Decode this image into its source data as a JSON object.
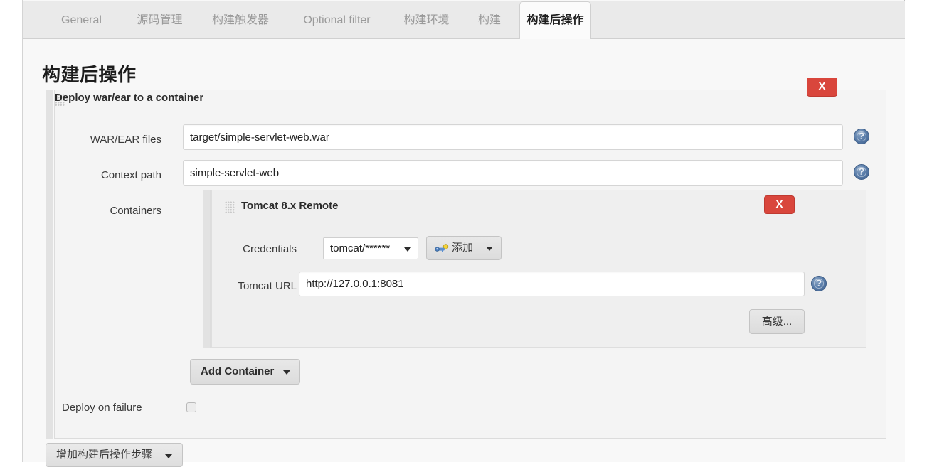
{
  "tabs": [
    {
      "label": "General",
      "active": false
    },
    {
      "label": "源码管理",
      "active": false
    },
    {
      "label": "构建触发器",
      "active": false
    },
    {
      "label": "Optional filter",
      "active": false
    },
    {
      "label": "构建环境",
      "active": false
    },
    {
      "label": "构建",
      "active": false
    },
    {
      "label": "构建后操作",
      "active": true
    }
  ],
  "page": {
    "title": "构建后操作"
  },
  "post_build_step": {
    "title": "Deploy war/ear to a container",
    "remove_label": "X",
    "fields": {
      "war_ear_files": {
        "label": "WAR/EAR files",
        "value": "target/simple-servlet-web.war",
        "help_icon": "help-icon"
      },
      "context_path": {
        "label": "Context path",
        "value": "simple-servlet-web",
        "help_icon": "help-icon"
      },
      "containers": {
        "label": "Containers"
      },
      "deploy_on_failure": {
        "label": "Deploy on failure",
        "checked": false
      }
    },
    "container": {
      "title": "Tomcat 8.x Remote",
      "remove_label": "X",
      "credentials": {
        "label": "Credentials",
        "selected": "tomcat/******",
        "add_button_label": "添加",
        "add_button_icon": "key-icon",
        "dropdown_icon": "chevron-down-icon"
      },
      "tomcat_url": {
        "label": "Tomcat URL",
        "value": "http://127.0.0.1:8081",
        "help_icon": "help-icon"
      },
      "advanced_button_label": "高级..."
    },
    "add_container_button": {
      "label": "Add Container",
      "dropdown_icon": "chevron-down-icon"
    }
  },
  "footer": {
    "add_post_build_step": {
      "label": "增加构建后操作步骤",
      "dropdown_icon": "chevron-down-icon"
    }
  },
  "colors": {
    "danger": "#d9463c",
    "help_blue": "#5c7fab",
    "panel_bg": "#f4f4f4",
    "inner_panel_bg": "#efefef"
  }
}
